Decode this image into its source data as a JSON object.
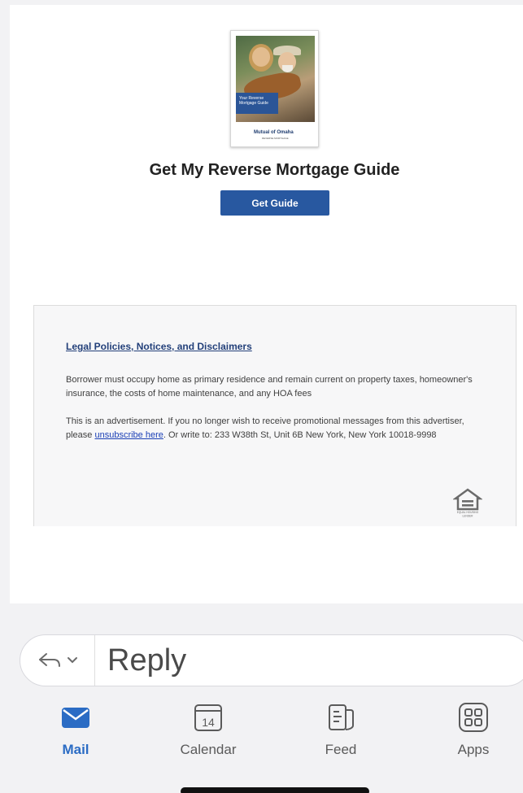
{
  "email": {
    "guide_cover": {
      "band_text": "Your Reverse Mortgage Guide",
      "brand_logo": "Mutual of Omaha",
      "brand_sub": "REVERSE MORTGAGE"
    },
    "headline": "Get My Reverse Mortgage Guide",
    "cta_label": "Get Guide",
    "legal": {
      "link_text": "Legal Policies, Notices, and Disclaimers",
      "paragraph1": "Borrower must occupy home as primary residence and remain current on property taxes, homeowner's insurance, the costs of home maintenance, and any HOA fees",
      "paragraph2_before": "This is an advertisement. If you no longer wish to receive promotional messages from this advertiser, please ",
      "unsubscribe_link": "unsubscribe here",
      "paragraph2_after": ". Or write to: 233 W38th St, Unit 6B New York, New York 10018-9998",
      "lender_badge": "EQUAL HOUSING LENDER"
    }
  },
  "reply_bar": {
    "label": "Reply",
    "icons": [
      "reply-arrow-icon",
      "chevron-down-icon"
    ]
  },
  "tab_bar": {
    "tabs": [
      {
        "label": "Mail",
        "icon": "mail-icon",
        "active": true
      },
      {
        "label": "Calendar",
        "icon": "calendar-icon",
        "badge": "14",
        "active": false
      },
      {
        "label": "Feed",
        "icon": "feed-icon",
        "active": false
      },
      {
        "label": "Apps",
        "icon": "apps-icon",
        "active": false
      }
    ]
  },
  "colors": {
    "accent": "#2b6cc4",
    "cta_button": "#2858a0",
    "link": "#23407a"
  }
}
